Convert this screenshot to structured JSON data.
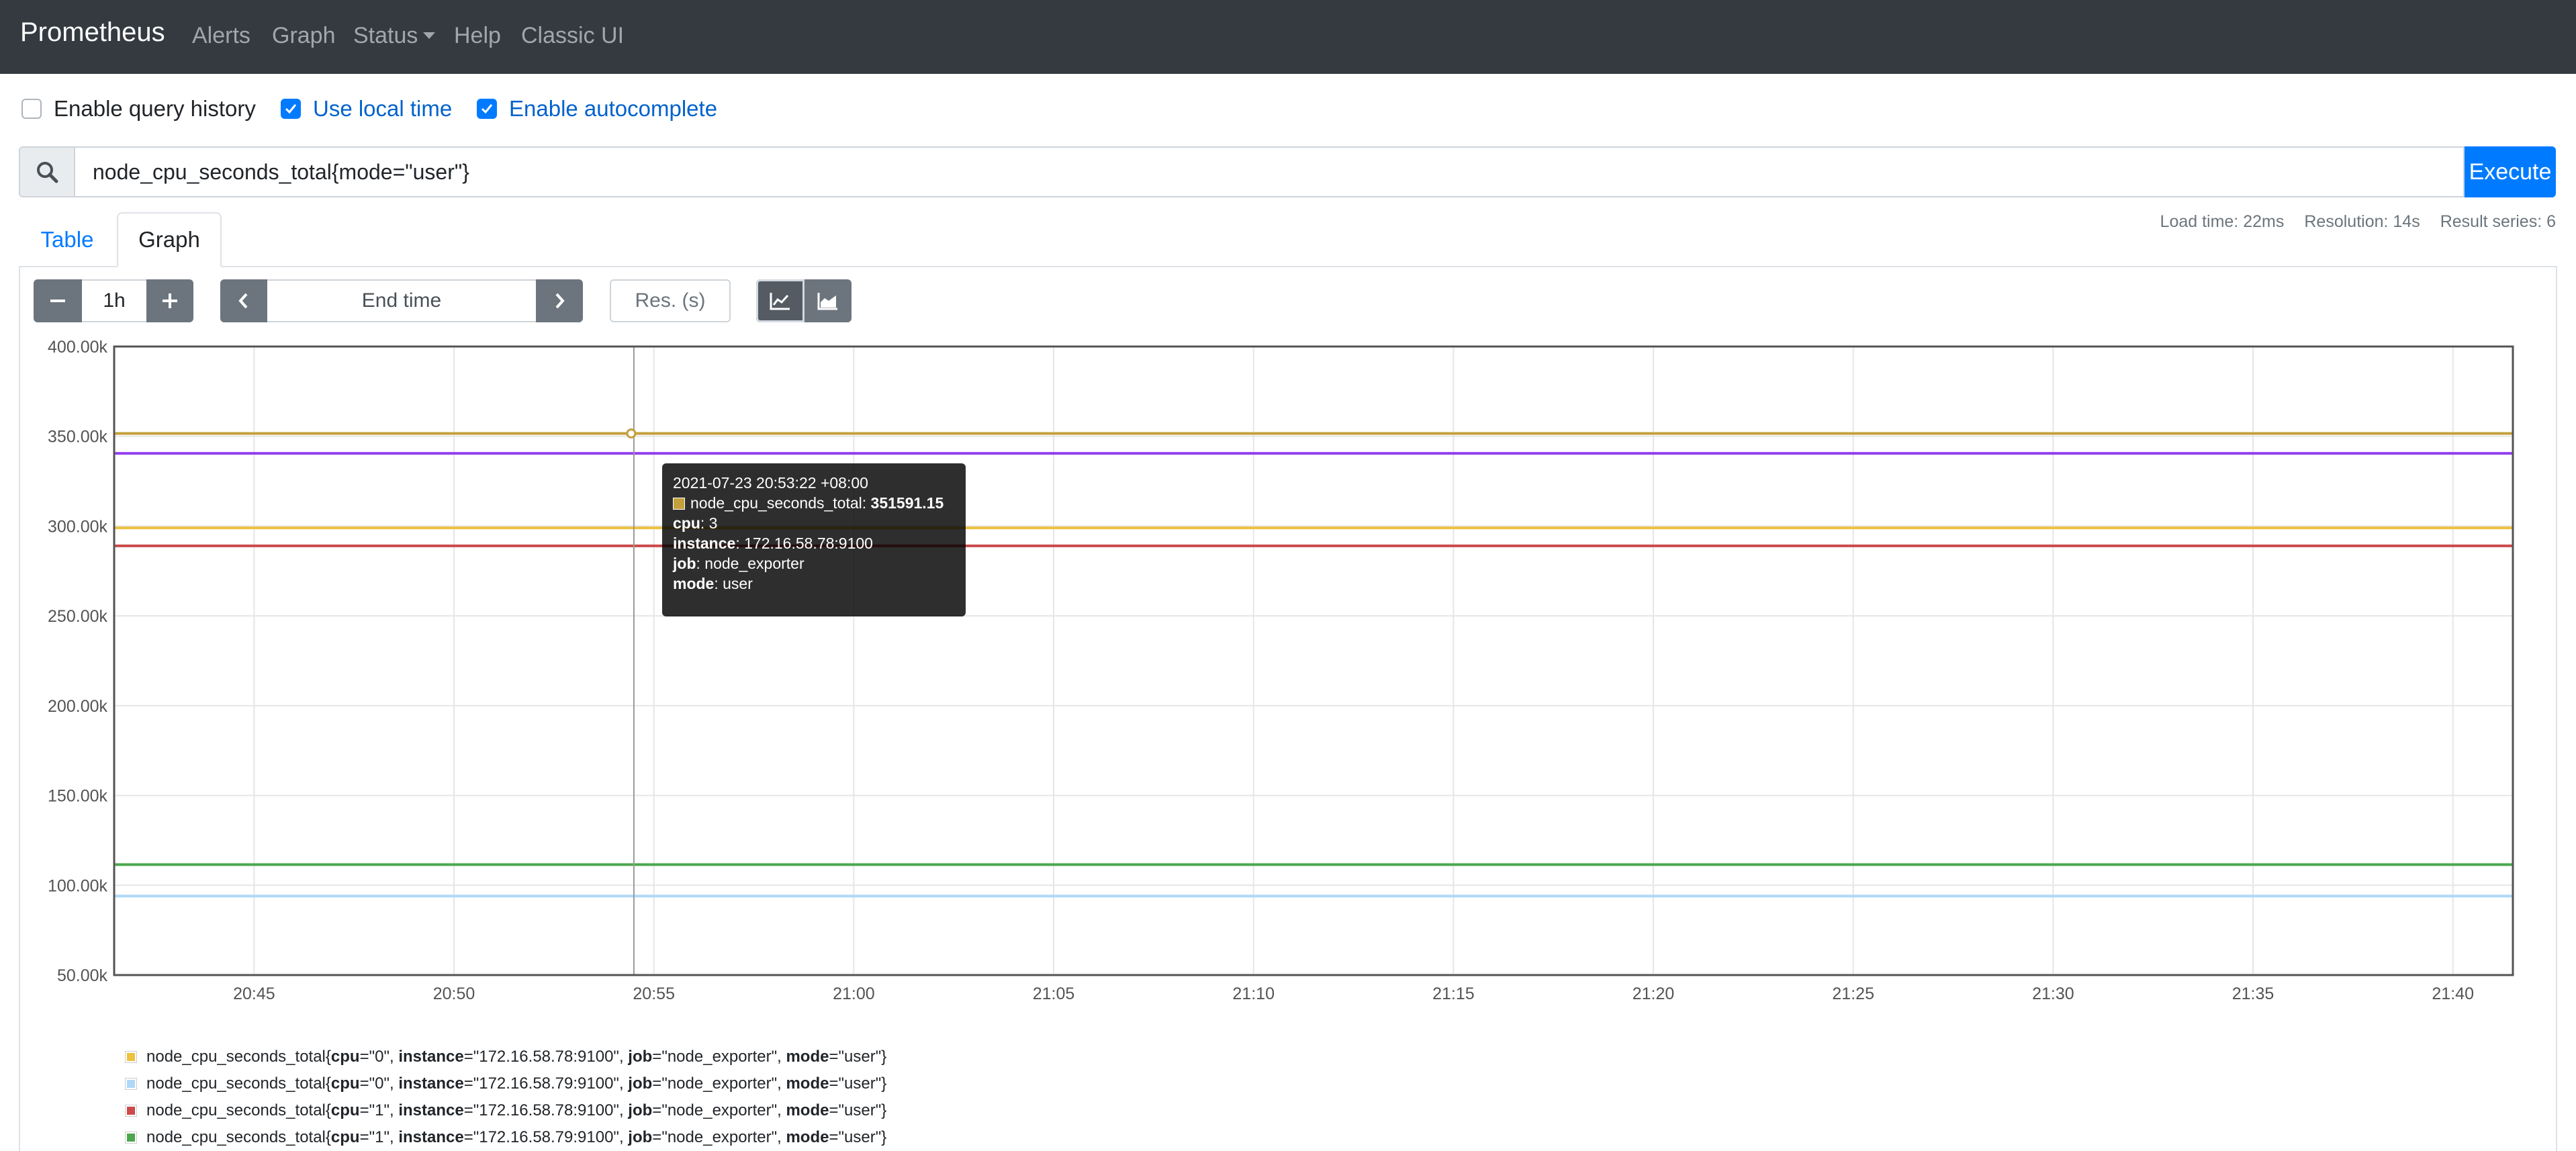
{
  "nav": {
    "brand": "Prometheus",
    "items": [
      "Alerts",
      "Graph",
      "Status",
      "Help",
      "Classic UI"
    ]
  },
  "options": {
    "query_history": {
      "label": "Enable query history",
      "checked": false
    },
    "local_time": {
      "label": "Use local time",
      "checked": true
    },
    "autocomplete": {
      "label": "Enable autocomplete",
      "checked": true
    }
  },
  "query": {
    "expression": "node_cpu_seconds_total{mode=\"user\"}",
    "execute_label": "Execute"
  },
  "tabs": {
    "table": "Table",
    "graph": "Graph"
  },
  "stats": {
    "load_time": "Load time: 22ms",
    "resolution": "Resolution: 14s",
    "result_series": "Result series: 6"
  },
  "controls": {
    "range": "1h",
    "end_time_placeholder": "End time",
    "resolution_placeholder": "Res. (s)"
  },
  "colors": {
    "accent": "#007bff",
    "navbar": "#343a40"
  },
  "tooltip": {
    "time": "2021-07-23 20:53:22 +08:00",
    "metric": "node_cpu_seconds_total",
    "value": "351591.15",
    "color": "#c4a03c",
    "labels": [
      {
        "key": "cpu",
        "value": "3"
      },
      {
        "key": "instance",
        "value": "172.16.58.78:9100"
      },
      {
        "key": "job",
        "value": "node_exporter"
      },
      {
        "key": "mode",
        "value": "user"
      }
    ]
  },
  "legend": [
    {
      "metric": "node_cpu_seconds_total",
      "cpu": "0",
      "instance": "172.16.58.78:9100",
      "job": "node_exporter",
      "mode": "user",
      "color": "#edc240"
    },
    {
      "metric": "node_cpu_seconds_total",
      "cpu": "0",
      "instance": "172.16.58.79:9100",
      "job": "node_exporter",
      "mode": "user",
      "color": "#afd8f8"
    },
    {
      "metric": "node_cpu_seconds_total",
      "cpu": "1",
      "instance": "172.16.58.78:9100",
      "job": "node_exporter",
      "mode": "user",
      "color": "#cb4b4b"
    },
    {
      "metric": "node_cpu_seconds_total",
      "cpu": "1",
      "instance": "172.16.58.79:9100",
      "job": "node_exporter",
      "mode": "user",
      "color": "#4da74d"
    }
  ],
  "chart_data": {
    "type": "line",
    "ylim": [
      50000,
      400000
    ],
    "yticks": [
      "400.00k",
      "350.00k",
      "300.00k",
      "250.00k",
      "200.00k",
      "150.00k",
      "100.00k",
      "50.00k"
    ],
    "ytick_values": [
      400000,
      350000,
      300000,
      250000,
      200000,
      150000,
      100000,
      50000
    ],
    "xticks": [
      "20:45",
      "20:50",
      "20:55",
      "21:00",
      "21:05",
      "21:10",
      "21:15",
      "21:20",
      "21:25",
      "21:30",
      "21:35",
      "21:40"
    ],
    "xlim": [
      "20:41:30",
      "21:41:30"
    ],
    "cursor_time": "20:54:30",
    "series": [
      {
        "values": [
          351591,
          351591
        ],
        "color": "#c4a03c"
      },
      {
        "values": [
          340500,
          340500
        ],
        "color": "#9440ed"
      },
      {
        "values": [
          299000,
          299000
        ],
        "color": "#edc240"
      },
      {
        "values": [
          289000,
          289000
        ],
        "color": "#cb4b4b"
      },
      {
        "values": [
          111500,
          111500
        ],
        "color": "#4da74d"
      },
      {
        "values": [
          94000,
          94000
        ],
        "color": "#afd8f8"
      }
    ]
  }
}
